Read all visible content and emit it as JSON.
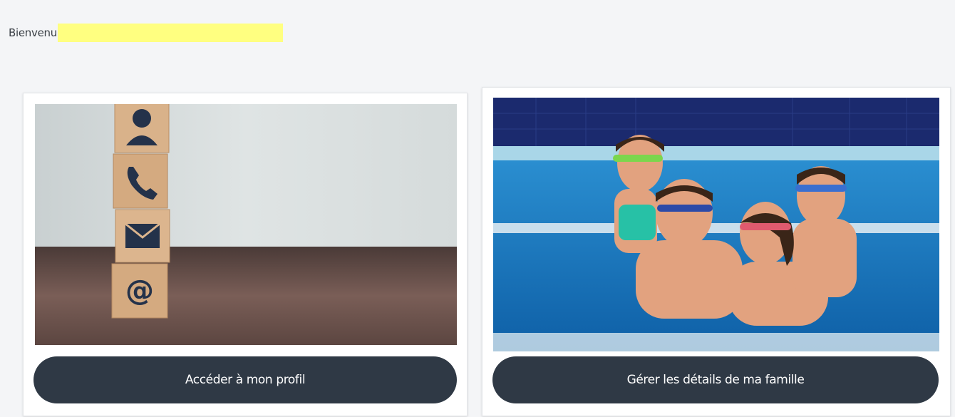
{
  "header": {
    "welcome_text": "Bienvenu"
  },
  "cards": [
    {
      "image_description": "wooden-blocks-contact-icons",
      "button_label": "Accéder à mon profil"
    },
    {
      "image_description": "family-in-swimming-pool",
      "button_label": "Gérer les détails de ma famille"
    }
  ],
  "colors": {
    "background": "#f4f5f7",
    "button": "#2f3945",
    "button_text": "#ffffff",
    "name_highlight": "#ffff80"
  }
}
